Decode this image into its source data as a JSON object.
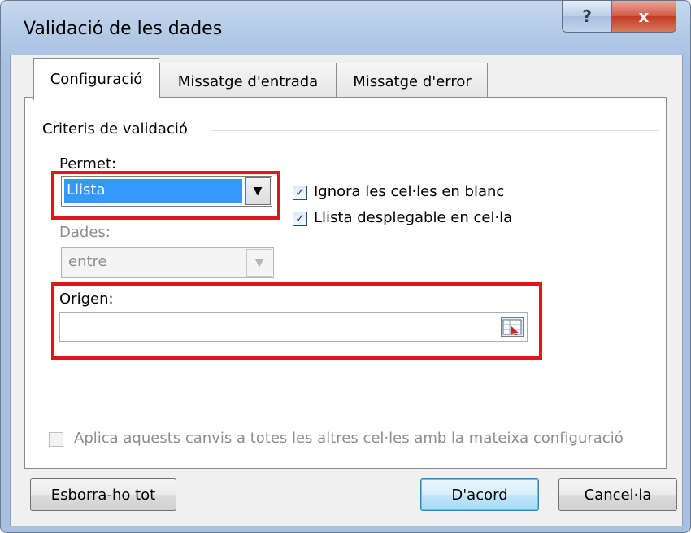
{
  "window": {
    "title": "Validació de les dades",
    "help_label": "?",
    "close_label": "x"
  },
  "tabs": [
    {
      "label": "Configuració",
      "active": true
    },
    {
      "label": "Missatge d'entrada",
      "active": false
    },
    {
      "label": "Missatge d'error",
      "active": false
    }
  ],
  "criteria": {
    "group_label": "Criteris de validació",
    "permet_label": "Permet:",
    "permet_value": "Llista",
    "dades_label": "Dades:",
    "dades_value": "entre",
    "ignore_blank_label": "Ignora les cel·les en blanc",
    "ignore_blank_checked": true,
    "in_cell_dropdown_label": "Llista desplegable en cel·la",
    "in_cell_dropdown_checked": true,
    "origen_label": "Origen:",
    "origen_value": ""
  },
  "apply_all": {
    "label": "Aplica aquests canvis a totes les altres cel·les amb la mateixa configuració",
    "checked": false
  },
  "buttons": {
    "clear_all": "Esborra-ho tot",
    "ok": "D'acord",
    "cancel": "Cancel·la"
  },
  "icons": {
    "dropdown": "chevron-down-icon",
    "range_picker": "range-selector-icon",
    "check": "check-icon"
  },
  "colors": {
    "highlight": "#e3141e",
    "selection": "#3399ff",
    "close_button": "#c23a22"
  }
}
